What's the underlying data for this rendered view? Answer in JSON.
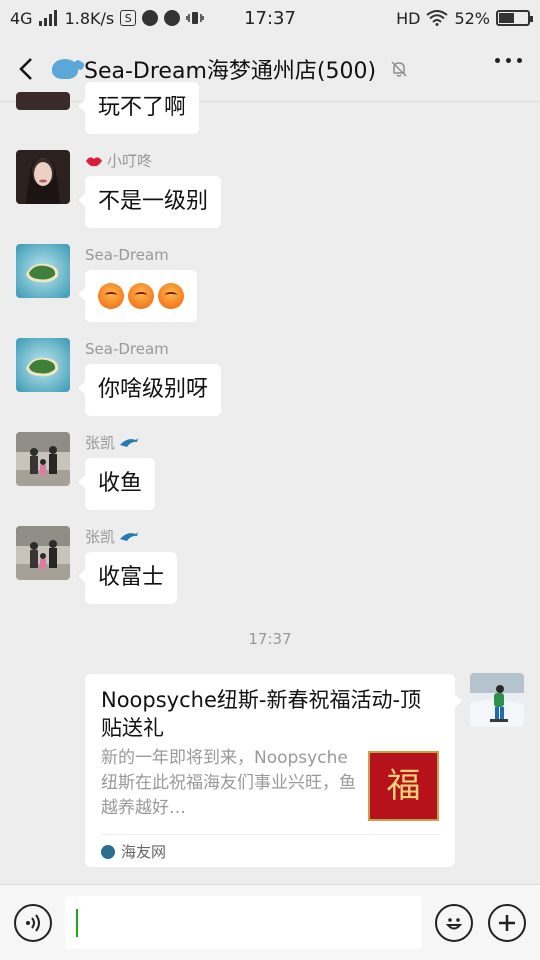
{
  "status_bar": {
    "network": "4G",
    "speed": "1.8K/s",
    "time": "17:37",
    "hd": "HD",
    "battery": "52%",
    "battery_level": 0.52,
    "icons": [
      "signal-icon",
      "s-app-icon",
      "chat-icon",
      "app-icon",
      "vibrate-icon",
      "wifi-icon",
      "battery-icon"
    ]
  },
  "header": {
    "title": "Sea-Dream海梦通州店(500)",
    "icons": [
      "back-icon",
      "whale-emoji-icon",
      "mute-bell-icon",
      "more-icon"
    ]
  },
  "messages": [
    {
      "sender": "",
      "text": "玩不了啊",
      "avatar": "girl-avatar"
    },
    {
      "sender": "小叮咚",
      "sender_prefix_icon": "lips-icon",
      "text": "不是一级别",
      "avatar": "girl-avatar"
    },
    {
      "sender": "Sea-Dream",
      "text": "",
      "emoji_count": 3,
      "emoji_icon": "angry-face-icon",
      "avatar": "island-avatar"
    },
    {
      "sender": "Sea-Dream",
      "text": "你啥级别呀",
      "avatar": "island-avatar"
    },
    {
      "sender": "张凯",
      "sender_suffix_icon": "dolphin-icon",
      "text": "收鱼",
      "avatar": "family-avatar"
    },
    {
      "sender": "张凯",
      "sender_suffix_icon": "dolphin-icon",
      "text": "收富士",
      "avatar": "family-avatar"
    }
  ],
  "timestamp": "17:37",
  "link_card": {
    "title": "Noopsyche纽斯-新春祝福活动-顶贴送礼",
    "description": "新的一年即将到来，Noopsyche纽斯在此祝福海友们事业兴旺，鱼越养越好…",
    "thumbnail_text": "福",
    "source": "海友网",
    "accent": "#b6121b"
  },
  "input_bar": {
    "icons": [
      "voice-icon",
      "emoji-icon",
      "plus-icon"
    ]
  },
  "colors": {
    "background": "#ededed",
    "bubble": "#ffffff",
    "caret": "#1aad19"
  }
}
